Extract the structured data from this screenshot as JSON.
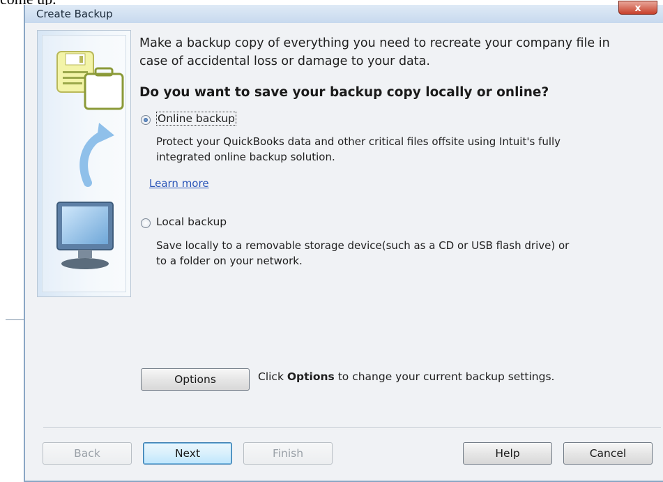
{
  "top_clip_text": "come up.",
  "window": {
    "title": "Create Backup",
    "close_label": "x"
  },
  "intro_text": "Make a backup copy of everything you need to recreate your company file in case of accidental loss or damage to your data.",
  "question": "Do you want to save your backup copy locally or online?",
  "options": [
    {
      "label": "Online backup",
      "selected": true,
      "description": "Protect your QuickBooks data and other critical files offsite using Intuit's fully integrated online backup solution.",
      "link": "Learn more"
    },
    {
      "label": "Local backup",
      "selected": false,
      "description": "Save locally to a removable storage device(such as a CD or USB flash drive) or to a folder on your network."
    }
  ],
  "options_button": "Options",
  "options_hint": {
    "prefix": "Click ",
    "bold": "Options",
    "suffix": " to change your current backup settings."
  },
  "footer_buttons": {
    "back": "Back",
    "next": "Next",
    "finish": "Finish",
    "help": "Help",
    "cancel": "Cancel"
  }
}
